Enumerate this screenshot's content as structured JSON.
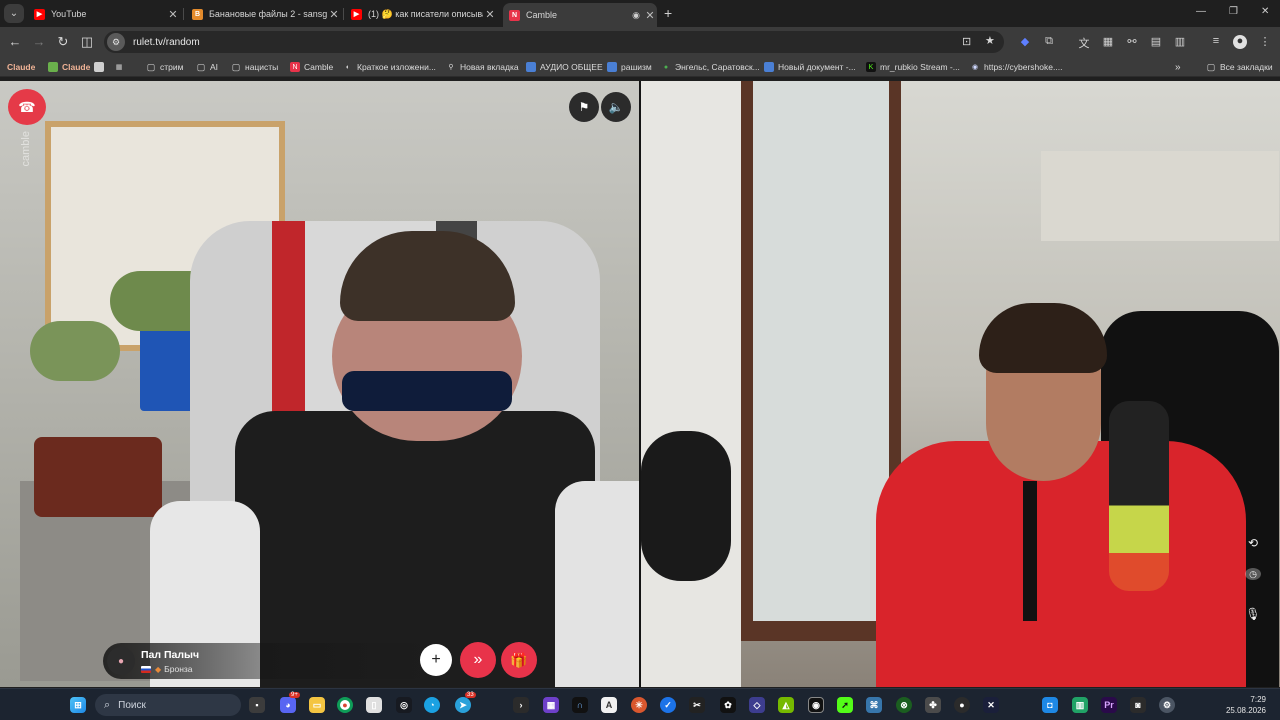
{
  "tabs": [
    {
      "label": "YouTube",
      "favicon_color": "#ff0000",
      "glyph": "▶"
    },
    {
      "label": "Банановые файлы 2 - sansgot",
      "favicon_color": "#e48b2c",
      "glyph": "B"
    },
    {
      "label": "(1) 🤔 как писатели описыва",
      "favicon_color": "#ff0000",
      "glyph": "▶"
    },
    {
      "label": "Camble",
      "favicon_color": "#e8334a",
      "glyph": "N"
    }
  ],
  "toolbar": {
    "url": "rulet.tv/random"
  },
  "bookmarks": [
    {
      "label": "Claude",
      "color": "#d97757",
      "glyph": ""
    },
    {
      "label": "Claude",
      "color": "#6ab04c",
      "glyph": ""
    },
    {
      "label": "",
      "color": "#cfcfcf",
      "glyph": ""
    },
    {
      "label": "",
      "color": "#cfcfcf",
      "glyph": "▦"
    },
    {
      "label": "стрим",
      "color": "#3b3b3b",
      "glyph": "▢"
    },
    {
      "label": "AI",
      "color": "#3b3b3b",
      "glyph": "▢"
    },
    {
      "label": "нацисты",
      "color": "#3b3b3b",
      "glyph": "▢"
    },
    {
      "label": "Camble",
      "color": "#e8334a",
      "glyph": "N"
    },
    {
      "label": "Краткое изложени...",
      "color": "#3b3b3b",
      "glyph": "◐"
    },
    {
      "label": "Новая вкладка",
      "color": "#3b3b3b",
      "glyph": "⚲"
    },
    {
      "label": "АУДИО ОБЩЕЕ",
      "color": "#4a7fd4",
      "glyph": ""
    },
    {
      "label": "рашизм",
      "color": "#4a7fd4",
      "glyph": ""
    },
    {
      "label": "Энгельс, Саратовск...",
      "color": "#3b3b3b",
      "glyph": "●"
    },
    {
      "label": "Новый документ -...",
      "color": "#4a7fd4",
      "glyph": ""
    },
    {
      "label": "mr_rubkio Stream -...",
      "color": "#53fc18",
      "glyph": "K"
    },
    {
      "label": "https://cybershoke....",
      "color": "#3b3b3b",
      "glyph": "◉"
    }
  ],
  "bookmarks_all": "Все закладки",
  "call": {
    "user_name": "Пал Палыч",
    "user_rank": "Бронза",
    "add_symbol": "+",
    "next_symbol": "»",
    "gift_symbol": "🎁",
    "watermark": "camble"
  },
  "taskbar": {
    "search_placeholder": "Поиск",
    "time": "7:29",
    "date": "25.08.2026",
    "badge_discord": "9+",
    "badge_telegram": "33"
  }
}
